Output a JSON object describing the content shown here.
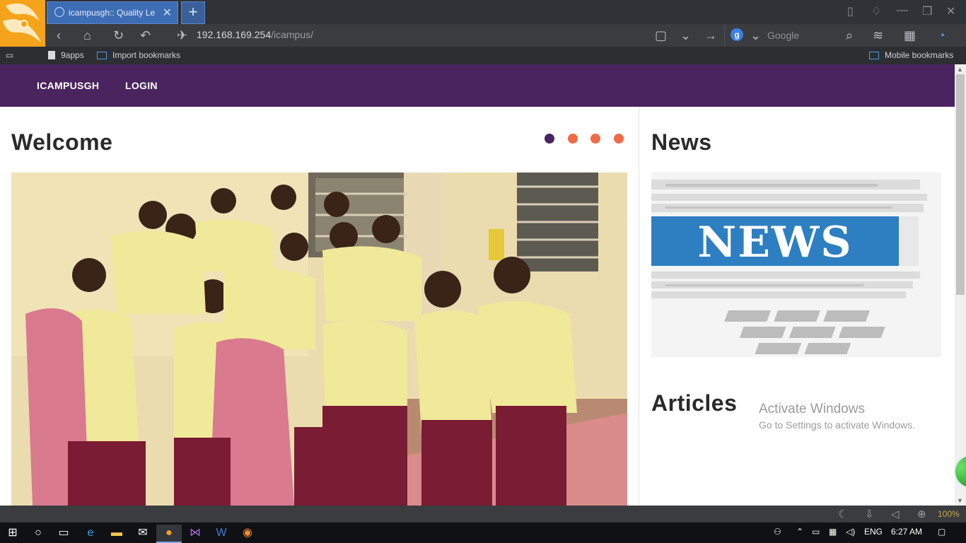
{
  "browser": {
    "tab_title": "icampusgh:: Quality Le",
    "tab_close": "✕",
    "new_tab": "+",
    "url_host": "192.168.169.254",
    "url_path": "/icampus/",
    "search_engine": "g",
    "search_placeholder": "Google",
    "bookmarks": [
      "9apps",
      "Import bookmarks"
    ],
    "mobile_bookmarks": "Mobile bookmarks",
    "zoom": "100%"
  },
  "site": {
    "nav": [
      "ICAMPUSGH",
      "LOGIN"
    ],
    "welcome_title": "Welcome",
    "news_title": "News",
    "articles_title": "Articles",
    "news_image_text": "NEWS",
    "slider_dots": 4,
    "active_slide": 1,
    "colors": {
      "nav_bg": "#4a245f",
      "dot": "#ee6a48",
      "dot_active": "#4a245f"
    }
  },
  "watermark": {
    "line1": "Activate Windows",
    "line2": "Go to Settings to activate Windows."
  },
  "taskbar": {
    "lang": "ENG",
    "time": "6:27 AM"
  }
}
